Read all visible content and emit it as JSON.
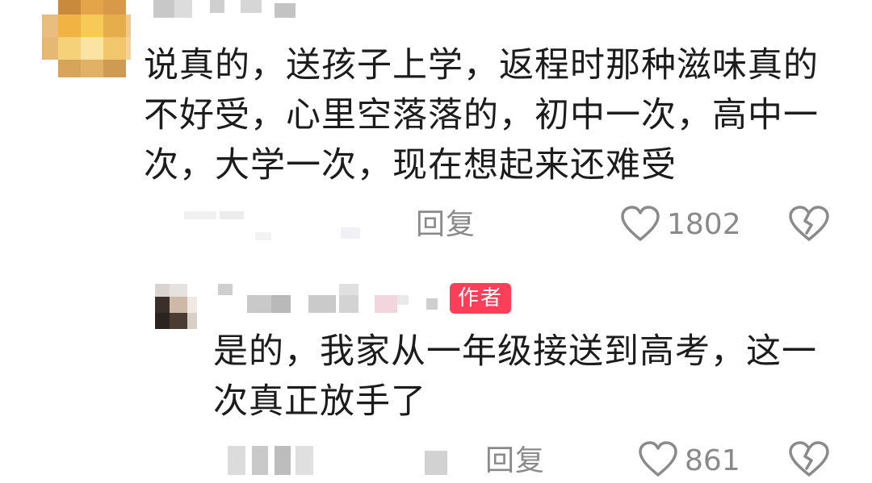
{
  "comments": [
    {
      "text_lines": [
        "说真的，送孩子上学，返程时那种滋味真的",
        "不好受，心里空落落的，初中一次，高中一",
        "次，大学一次，现在想起来还难受"
      ],
      "reply_label": "回复",
      "like_count": "1802"
    },
    {
      "badge": "作者",
      "text_lines": [
        "是的，我家从一年级接送到高考，这一",
        "次真正放手了"
      ],
      "reply_label": "回复",
      "like_count": "861"
    }
  ],
  "icons": {
    "like": "heart-outline-icon",
    "dislike": "broken-heart-icon"
  },
  "colors": {
    "text": "#1c1c1c",
    "meta": "#8a8a8a",
    "author_badge": "#ff3f5a"
  }
}
